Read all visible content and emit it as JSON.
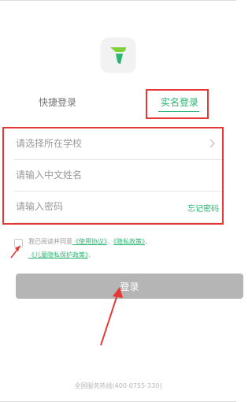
{
  "tabs": {
    "quick_login": "快捷登录",
    "real_name_login": "实名登录"
  },
  "form": {
    "school_placeholder": "请选择所在学校",
    "name_placeholder": "请输入中文姓名",
    "password_placeholder": "请输入密码",
    "forgot_password": "忘记密码"
  },
  "agreement": {
    "prefix": "我已阅读并同意",
    "terms_link": "《使用协议》",
    "separator": "、",
    "privacy_link": "《隐私政策》",
    "children_privacy_link": "《儿童隐私保护政策》"
  },
  "login_button": "登录",
  "footer": {
    "hotline": "全国服务热线(400-0755-330)"
  },
  "colors": {
    "accent": "#2bb673",
    "annotation": "#e53935",
    "button_disabled": "#b5b5b5"
  }
}
